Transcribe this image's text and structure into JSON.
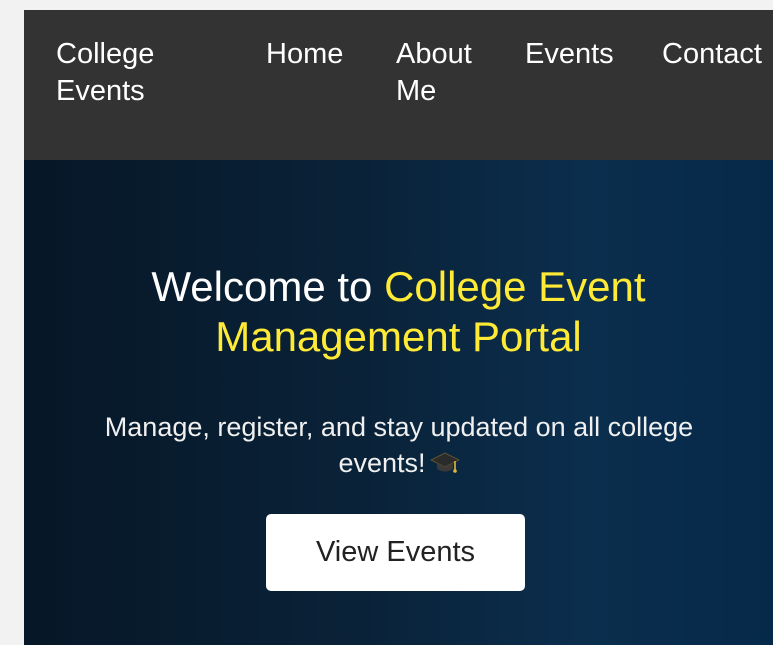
{
  "navbar": {
    "brand": "College Events",
    "links": [
      {
        "label": "Home"
      },
      {
        "label": "About Me"
      },
      {
        "label": "Events"
      },
      {
        "label": "Contact"
      }
    ]
  },
  "hero": {
    "title_prefix": "Welcome to ",
    "title_highlight": "College Event Management Portal",
    "subtitle": "Manage, register, and stay updated on all college events!",
    "subtitle_icon": "graduation-cap-icon",
    "button_label": "View Events"
  },
  "colors": {
    "navbar_bg": "#333333",
    "hero_bg_dark": "#061727",
    "hero_bg_light": "#0b2e4d",
    "accent": "#ffea36",
    "button_bg": "#ffffff"
  }
}
